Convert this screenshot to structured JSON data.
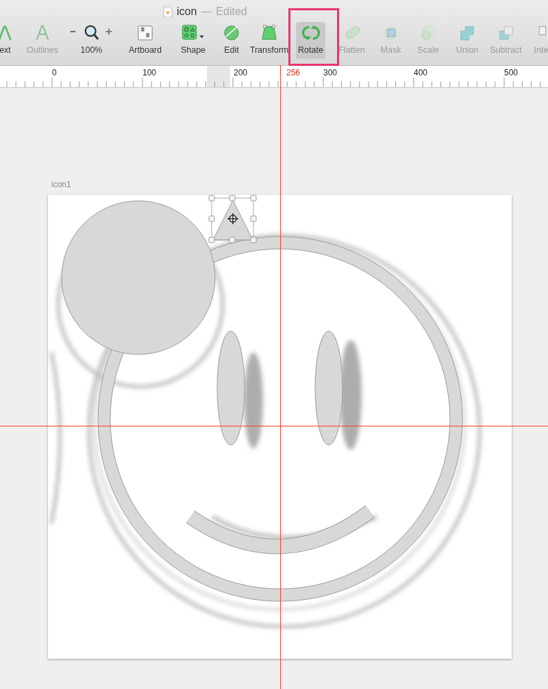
{
  "window": {
    "title": "icon",
    "separator": "—",
    "status": "Edited"
  },
  "toolbar": [
    {
      "label": "ext",
      "kind": "text",
      "disabled": false,
      "selected": false,
      "highlighted": false
    },
    {
      "label": "Outlines",
      "kind": "outlines",
      "disabled": true,
      "selected": false,
      "highlighted": false
    },
    {
      "label": "100%",
      "kind": "zoom",
      "disabled": false,
      "selected": false,
      "highlighted": false
    },
    {
      "label": "Artboard",
      "kind": "artboard",
      "disabled": false,
      "selected": false,
      "highlighted": false
    },
    {
      "label": "Shape",
      "kind": "shape",
      "disabled": false,
      "selected": false,
      "highlighted": false
    },
    {
      "label": "Edit",
      "kind": "edit",
      "disabled": false,
      "selected": false,
      "highlighted": false
    },
    {
      "label": "Transform",
      "kind": "transform",
      "disabled": false,
      "selected": false,
      "highlighted": false
    },
    {
      "label": "Rotate",
      "kind": "rotate",
      "disabled": false,
      "selected": true,
      "highlighted": true
    },
    {
      "label": "Flatten",
      "kind": "flatten",
      "disabled": true,
      "selected": false,
      "highlighted": false
    },
    {
      "label": "Mask",
      "kind": "mask",
      "disabled": true,
      "selected": false,
      "highlighted": false
    },
    {
      "label": "Scale",
      "kind": "scale",
      "disabled": true,
      "selected": false,
      "highlighted": false
    },
    {
      "label": "Union",
      "kind": "union",
      "disabled": true,
      "selected": false,
      "highlighted": false
    },
    {
      "label": "Subtract",
      "kind": "subtract",
      "disabled": true,
      "selected": false,
      "highlighted": false
    },
    {
      "label": "Inte",
      "kind": "intersect",
      "disabled": true,
      "selected": false,
      "highlighted": false
    }
  ],
  "ruler": [
    {
      "label": "0",
      "selected": false
    },
    {
      "label": "100",
      "selected": false
    },
    {
      "label": "200",
      "selected": false
    },
    {
      "label": "256",
      "selected": true
    },
    {
      "label": "300",
      "selected": false
    },
    {
      "label": "400",
      "selected": false
    },
    {
      "label": "500",
      "selected": false
    }
  ],
  "artboard": {
    "name": "icon1"
  }
}
